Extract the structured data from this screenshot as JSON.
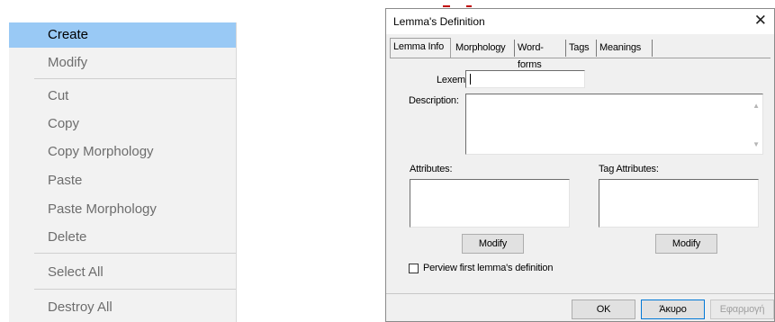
{
  "context_menu": {
    "items": [
      {
        "label": "Create"
      },
      {
        "label": "Modify"
      },
      {
        "label": "Cut"
      },
      {
        "label": "Copy"
      },
      {
        "label": "Copy Morphology"
      },
      {
        "label": "Paste"
      },
      {
        "label": "Paste Morphology"
      },
      {
        "label": "Delete"
      },
      {
        "label": "Select All"
      },
      {
        "label": "Destroy All"
      }
    ],
    "highlight_color": "#99c9f5"
  },
  "dialog": {
    "title": "Lemma's Definition",
    "close_glyph": "✕",
    "tabs": [
      {
        "label": "Lemma Info"
      },
      {
        "label": "Morphology"
      },
      {
        "label": "Word-forms"
      },
      {
        "label": "Tags"
      },
      {
        "label": "Meanings"
      }
    ],
    "lexeme": {
      "label": "Lexeme:",
      "value": ""
    },
    "description": {
      "label": "Description:",
      "value": ""
    },
    "attributes": {
      "label": "Attributes:",
      "modify_label": "Modify"
    },
    "tag_attributes": {
      "label": "Tag Attributes:",
      "modify_label": "Modify"
    },
    "preview": {
      "label": "Perview first lemma's definition",
      "checked": false
    },
    "footer": {
      "ok_label": "OK",
      "cancel_label": "Άκυρο",
      "apply_label": "Εφαρμογή"
    }
  }
}
